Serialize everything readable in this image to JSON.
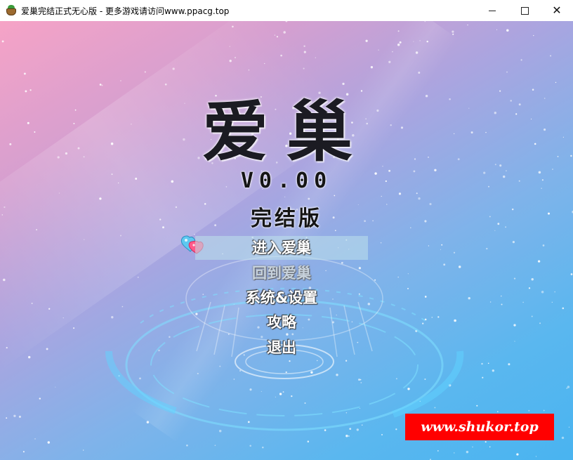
{
  "window": {
    "title": "爱巢完结正式无心版 - 更多游戏请访问www.ppacg.top",
    "app_icon": "app-icon",
    "controls": {
      "minimize_icon": "minimize-icon",
      "maximize_icon": "maximize-icon",
      "close_icon": "close-icon",
      "close_glyph": "✕"
    }
  },
  "game": {
    "title": "爱巢",
    "version": "V0.00",
    "subtitle": "完结版",
    "menu": {
      "items": [
        {
          "label": "进入爱巢",
          "state": "selected"
        },
        {
          "label": "回到爱巢",
          "state": "disabled"
        },
        {
          "label": "系统&设置",
          "state": "normal"
        },
        {
          "label": "攻略",
          "state": "normal"
        },
        {
          "label": "退出",
          "state": "normal"
        }
      ],
      "cursor_icon": "heart-cursor-icon"
    },
    "watermark": "www.shukor.top"
  },
  "colors": {
    "background_pink": "#f6a3c6",
    "background_blue": "#49b4f0",
    "watermark_bg": "#ff0000",
    "selection_highlight": "#bee1eb"
  }
}
